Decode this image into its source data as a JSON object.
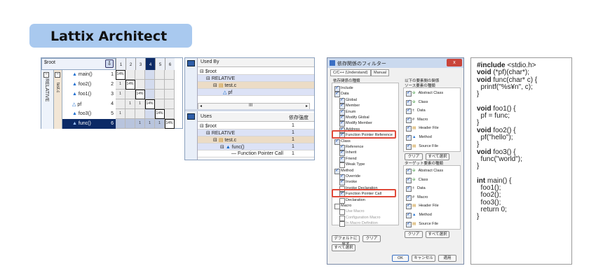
{
  "title": "Lattix Architect",
  "dsm": {
    "root": "$root",
    "group": "RELATIVE",
    "file": "test.c",
    "col_headers": [
      "1",
      "2",
      "3",
      "4",
      "5",
      "6"
    ],
    "rows": [
      {
        "label": "main()",
        "num": "1"
      },
      {
        "label": "foo2()",
        "num": "2"
      },
      {
        "label": "foo1()",
        "num": "3"
      },
      {
        "label": "pf",
        "num": "4"
      },
      {
        "label": "foo3()",
        "num": "5"
      },
      {
        "label": "func()",
        "num": "6"
      }
    ],
    "cells": [
      {
        "r": 0,
        "c": 0,
        "v": "14%"
      },
      {
        "r": 1,
        "c": 0,
        "v": "1"
      },
      {
        "r": 1,
        "c": 1,
        "v": "14%"
      },
      {
        "r": 2,
        "c": 0,
        "v": "1"
      },
      {
        "r": 2,
        "c": 2,
        "v": "14%"
      },
      {
        "r": 3,
        "c": 1,
        "v": "1"
      },
      {
        "r": 3,
        "c": 2,
        "v": "1"
      },
      {
        "r": 3,
        "c": 3,
        "v": "14%"
      },
      {
        "r": 4,
        "c": 0,
        "v": "1"
      },
      {
        "r": 4,
        "c": 4,
        "v": "14%"
      },
      {
        "r": 5,
        "c": 2,
        "v": "1"
      },
      {
        "r": 5,
        "c": 3,
        "v": "1"
      },
      {
        "r": 5,
        "c": 4,
        "v": "1"
      },
      {
        "r": 5,
        "c": 5,
        "v": "14%"
      }
    ]
  },
  "used_by": {
    "header": "Used By",
    "rows": [
      "$root",
      "RELATIVE",
      "test.c",
      "pf"
    ],
    "scroll_label": "III"
  },
  "uses": {
    "header": "Uses",
    "value_header": "依存強度",
    "rows": [
      {
        "label": "$root",
        "v": "1"
      },
      {
        "label": "RELATIVE",
        "v": "1"
      },
      {
        "label": "test.c",
        "v": "1"
      },
      {
        "label": "func()",
        "v": "1"
      },
      {
        "label": "Function Pointer Call",
        "v": "1"
      }
    ]
  },
  "dialog": {
    "title": "依存関係のフィルター",
    "close": "x",
    "tabs": [
      "C/C++ (Understand)",
      "Manual"
    ],
    "left_group_label": "依存関係の種類",
    "left_items": [
      "Include",
      "Data",
      "Global",
      "Member",
      "Enum",
      "Modify Global",
      "Modify Member",
      "Address",
      "Function Pointer Reference",
      "Class",
      "Reference",
      "Inherit",
      "Friend",
      "Weak Type",
      "Method",
      "Override",
      "Invoke",
      "Invoke Declaration",
      "Function Pointer Call",
      "Declaration",
      "Macro",
      "Use Macro",
      "Configuration Macro",
      "In Macro Definition"
    ],
    "right_top_label": "以下の要素間の関係",
    "source_label": "ソース要素の種類",
    "target_label": "ターゲット要素の種類",
    "kinds": [
      "Abstract Class",
      "Class",
      "Data",
      "Macro",
      "Header File",
      "Method",
      "Source File"
    ],
    "clear": "クリア",
    "select_all": "すべて選択",
    "default_btn": "デフォルトに戻す",
    "ok": "OK",
    "cancel": "キャンセル",
    "apply": "適用"
  },
  "code": [
    {
      "kw": "#include",
      "rest": " <stdio.h>"
    },
    {
      "kw": "void",
      "rest": " (*pf)(char*);"
    },
    {
      "kw": "void",
      "rest": " func(char* c) {"
    },
    {
      "kw": "",
      "rest": "  printf(\"%s¥n\", c);"
    },
    {
      "kw": "",
      "rest": "}"
    },
    {
      "kw": "",
      "rest": ""
    },
    {
      "kw": "void",
      "rest": " foo1() {"
    },
    {
      "kw": "",
      "rest": "  pf = func;"
    },
    {
      "kw": "",
      "rest": "}"
    },
    {
      "kw": "void",
      "rest": " foo2() {"
    },
    {
      "kw": "",
      "rest": "  pf(\"hello\");"
    },
    {
      "kw": "",
      "rest": "}"
    },
    {
      "kw": "void",
      "rest": " foo3() {"
    },
    {
      "kw": "",
      "rest": "  func(\"world\");"
    },
    {
      "kw": "",
      "rest": "}"
    },
    {
      "kw": "",
      "rest": ""
    },
    {
      "kw": "int",
      "rest": " main() {"
    },
    {
      "kw": "",
      "rest": "  foo1();"
    },
    {
      "kw": "",
      "rest": "  foo2();"
    },
    {
      "kw": "",
      "rest": "  foo3();"
    },
    {
      "kw": "",
      "rest": "  return 0;"
    },
    {
      "kw": "",
      "rest": "}"
    }
  ]
}
